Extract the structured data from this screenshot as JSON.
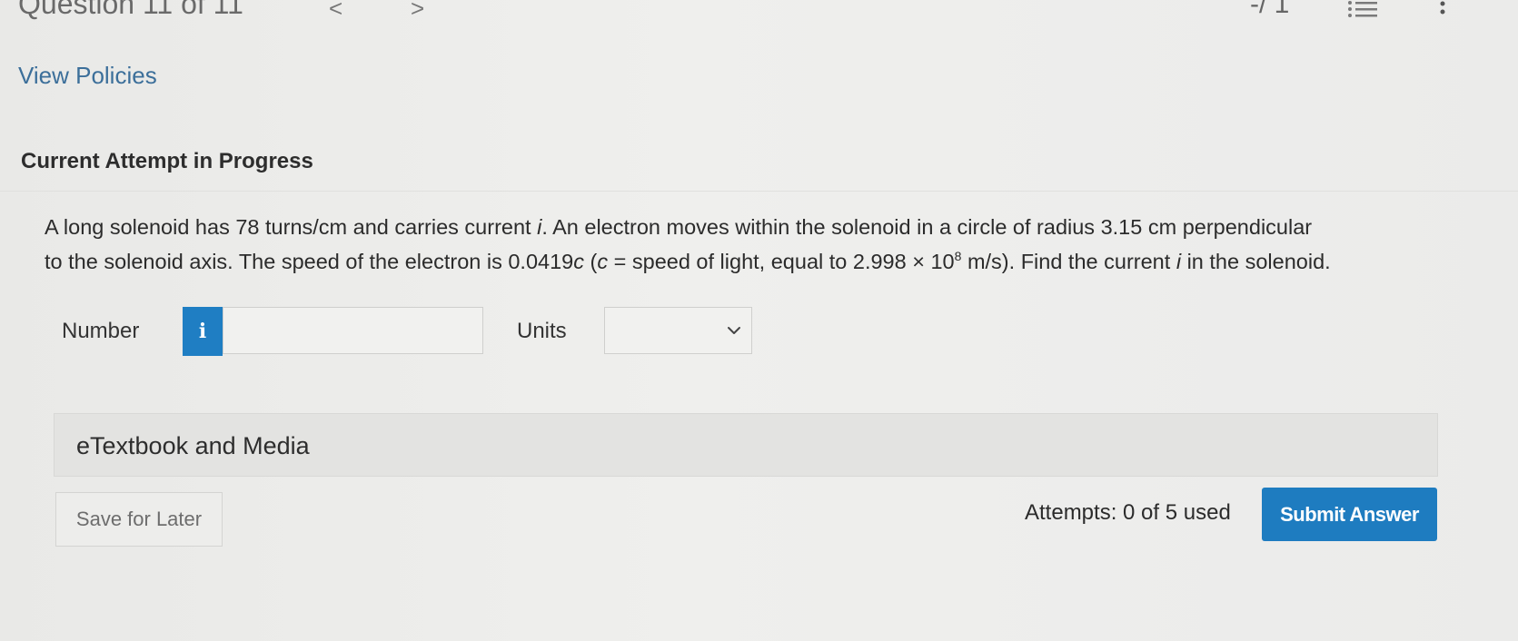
{
  "header": {
    "question_counter": "Question 11 of 11",
    "prev_glyph": "<",
    "next_glyph": ">",
    "score": "-/ 1"
  },
  "links": {
    "view_policies": "View Policies"
  },
  "attempt": {
    "heading": "Current Attempt in Progress"
  },
  "question": {
    "line1_part1": "A long solenoid has 78 turns/cm and carries current ",
    "line1_var_i": "i",
    "line1_part2": ". An electron moves within the solenoid in a circle of radius 3.15 cm perpendicular",
    "line2_part1": "to the solenoid axis. The speed of the electron is 0.0419",
    "line2_var_c1": "c",
    "line2_part2": " (",
    "line2_var_c2": "c",
    "line2_part3": " = speed of light, equal to 2.998 × 10",
    "line2_exponent": "8",
    "line2_part4": " m/s). Find the current ",
    "line2_var_i": "i",
    "line2_part5": " in the solenoid."
  },
  "answer": {
    "number_label": "Number",
    "info_glyph": "i",
    "number_value": "",
    "units_label": "Units",
    "units_selected": ""
  },
  "etextbook": {
    "label": "eTextbook and Media"
  },
  "footer": {
    "save_label": "Save for Later",
    "attempts": "Attempts: 0 of 5 used",
    "submit_label": "Submit Answer"
  }
}
